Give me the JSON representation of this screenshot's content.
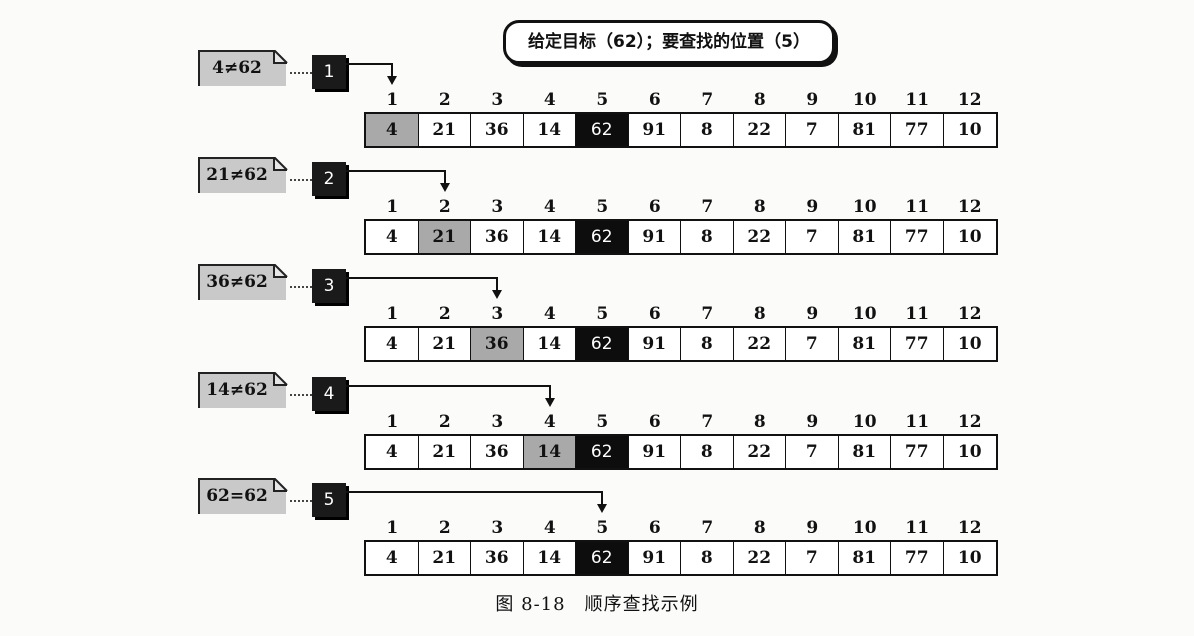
{
  "title": "给定目标（62）；要查找的位置（5）",
  "indices": [
    "1",
    "2",
    "3",
    "4",
    "5",
    "6",
    "7",
    "8",
    "9",
    "10",
    "11",
    "12"
  ],
  "values": [
    "4",
    "21",
    "36",
    "14",
    "62",
    "91",
    "8",
    "22",
    "7",
    "81",
    "77",
    "10"
  ],
  "steps": [
    {
      "num": "1",
      "comparison": "4≠62",
      "checked_index": 1
    },
    {
      "num": "2",
      "comparison": "21≠62",
      "checked_index": 2
    },
    {
      "num": "3",
      "comparison": "36≠62",
      "checked_index": 3
    },
    {
      "num": "4",
      "comparison": "14≠62",
      "checked_index": 4
    },
    {
      "num": "5",
      "comparison": "62=62",
      "checked_index": 5
    }
  ],
  "target_index": 5,
  "caption": "图 8-18　顺序查找示例",
  "colors": {
    "checked_cell": "#a9a9a9",
    "target_cell": "#0d0d0d",
    "note_fill": "#c9c9c9"
  }
}
